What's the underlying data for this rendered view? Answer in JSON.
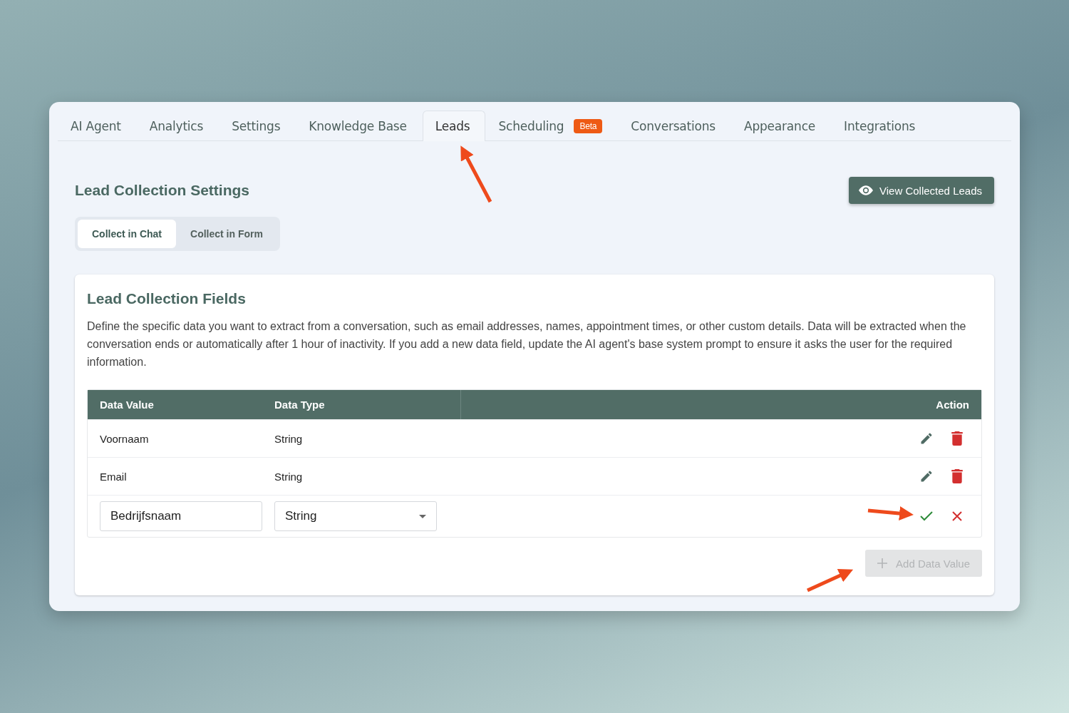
{
  "tabs": [
    {
      "label": "AI Agent",
      "selected": false
    },
    {
      "label": "Analytics",
      "selected": false
    },
    {
      "label": "Settings",
      "selected": false
    },
    {
      "label": "Knowledge Base",
      "selected": false
    },
    {
      "label": "Leads",
      "selected": true
    },
    {
      "label": "Scheduling",
      "selected": false,
      "badge": "Beta"
    },
    {
      "label": "Conversations",
      "selected": false
    },
    {
      "label": "Appearance",
      "selected": false
    },
    {
      "label": "Integrations",
      "selected": false
    }
  ],
  "page_title": "Lead Collection Settings",
  "view_button": "View Collected Leads",
  "mode_toggle": [
    {
      "label": "Collect in Chat",
      "selected": true
    },
    {
      "label": "Collect in Form",
      "selected": false
    }
  ],
  "fields_card": {
    "title": "Lead Collection Fields",
    "description": "Define the specific data you want to extract from a conversation, such as email addresses, names, appointment times, or other custom details. Data will be extracted when the conversation ends or automatically after 1 hour of inactivity. If you add a new data field, update the AI agent's base system prompt to ensure it asks the user for the required information.",
    "table": {
      "columns": [
        "Data Value",
        "Data Type",
        "Action"
      ],
      "rows": [
        {
          "kind": "display",
          "value": "Voornaam",
          "type": "String"
        },
        {
          "kind": "display",
          "value": "Email",
          "type": "String"
        },
        {
          "kind": "edit",
          "value": "Bedrijfsnaam",
          "type": "String"
        }
      ]
    },
    "add_button": {
      "label": "Add Data Value",
      "disabled": true
    }
  }
}
